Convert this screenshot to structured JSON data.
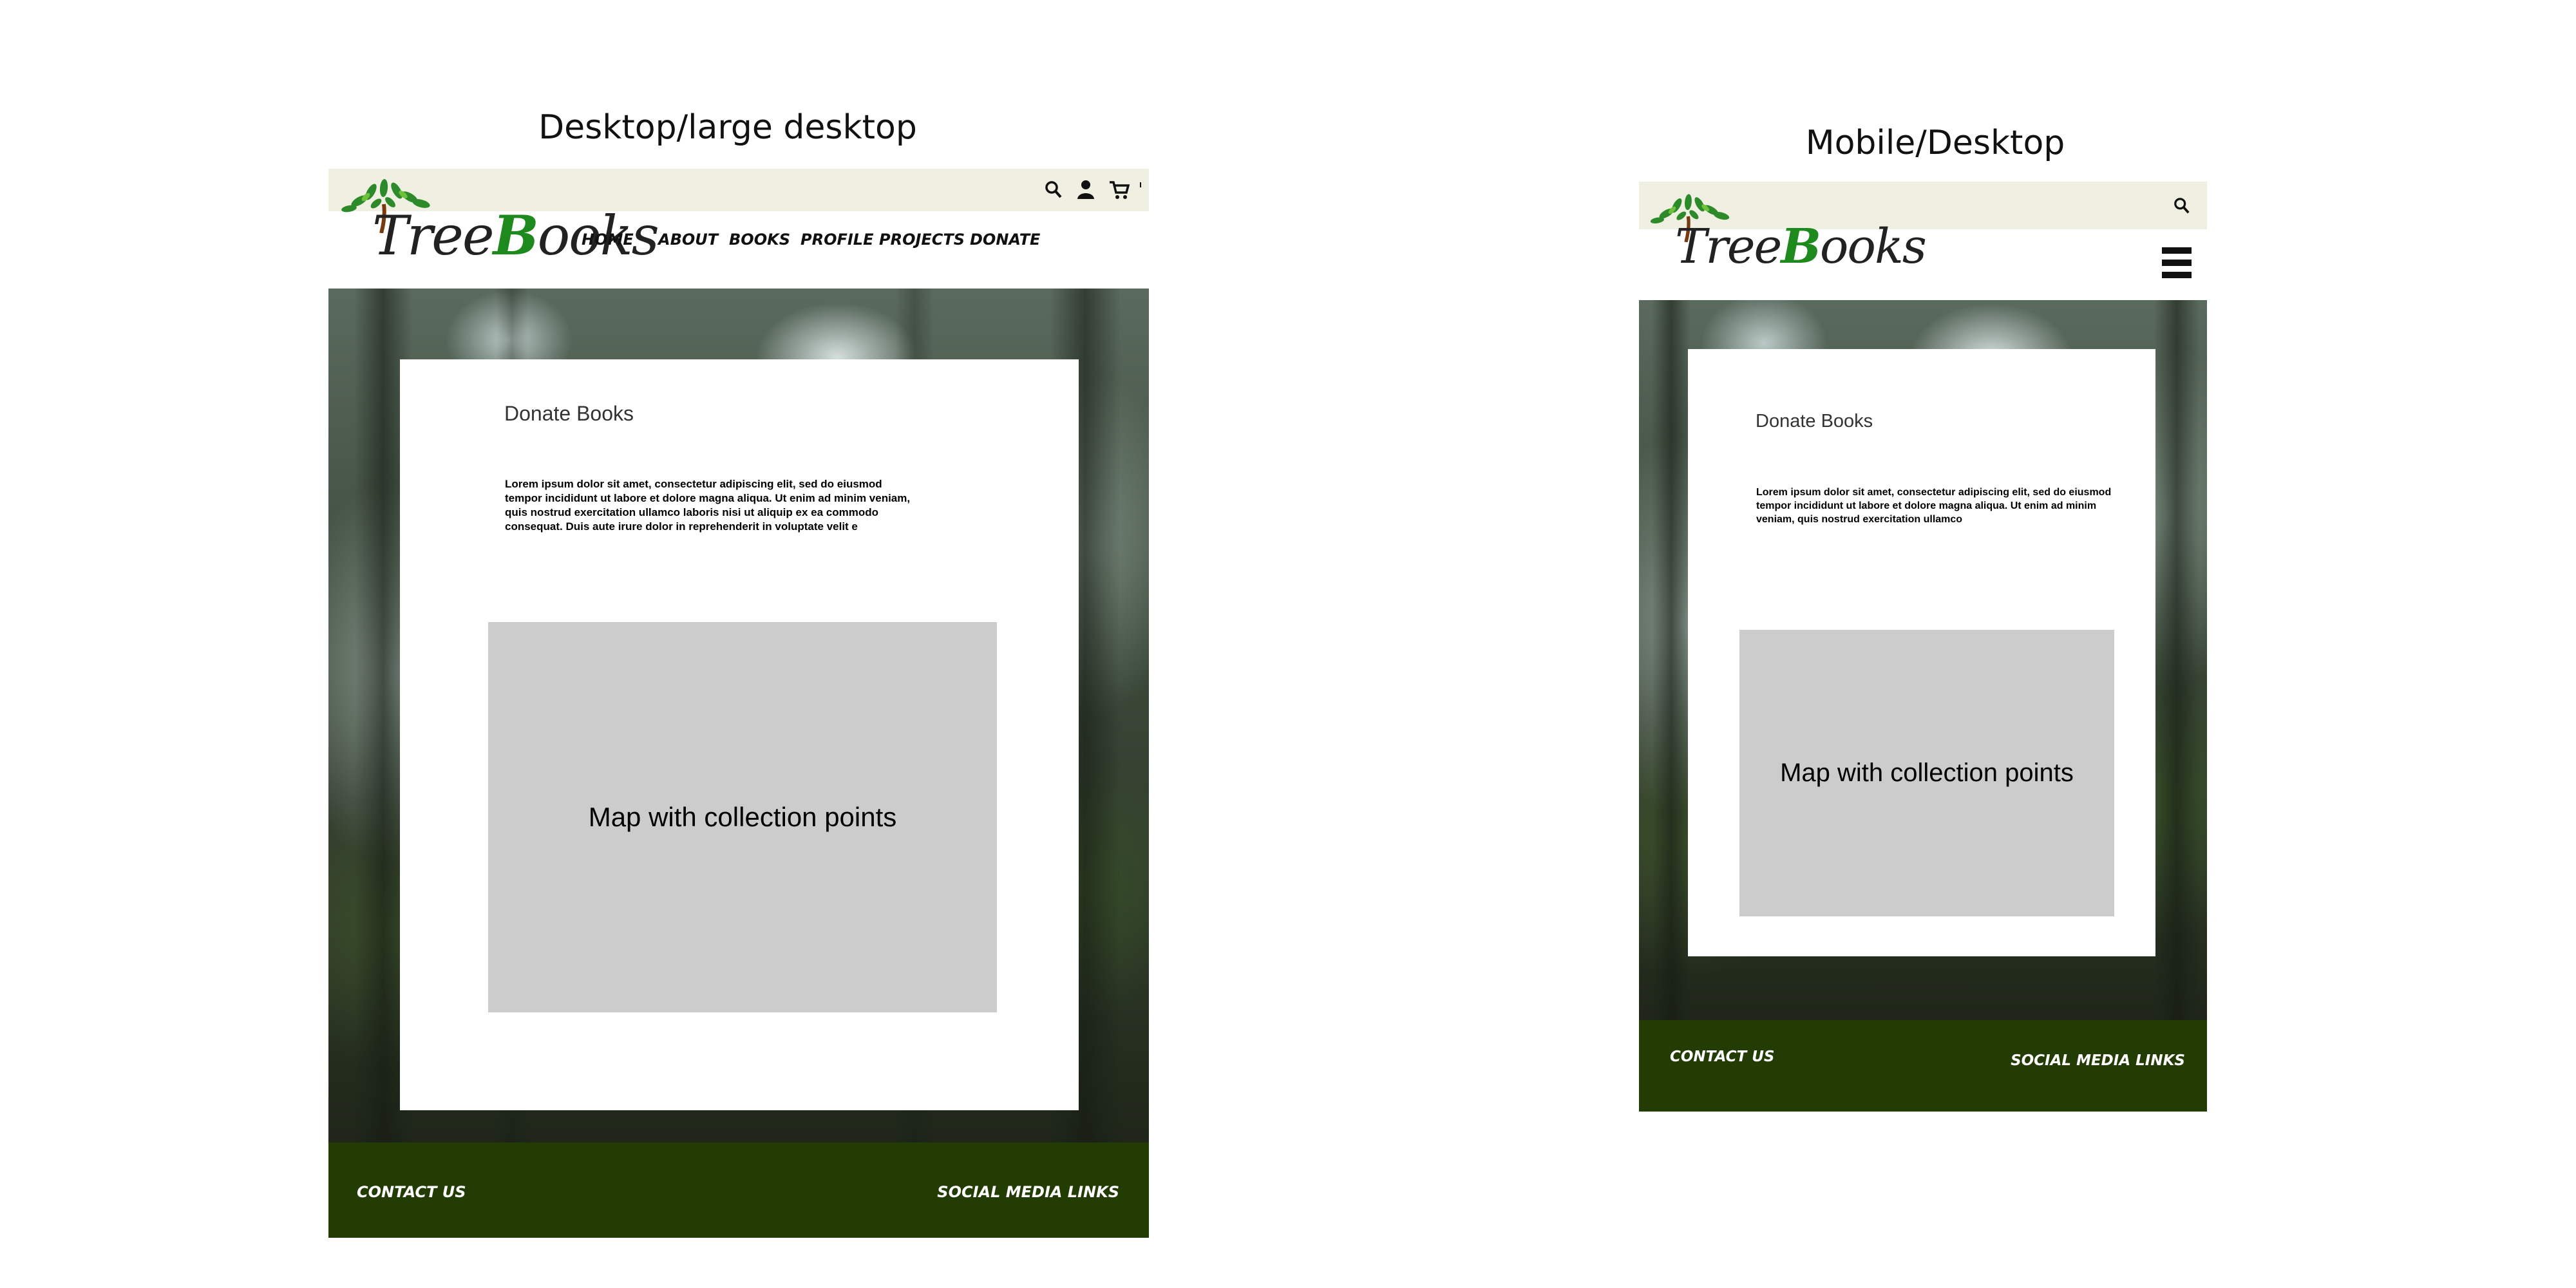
{
  "desktop": {
    "heading": "Desktop/large desktop",
    "logo": {
      "text_before": "Tree",
      "text_b": "B",
      "text_after": "ooks"
    },
    "nav": [
      {
        "label": "HOME"
      },
      {
        "label": "ABOUT"
      },
      {
        "label": "BOOKS"
      },
      {
        "label": "PROFILE"
      },
      {
        "label": "PROJECTS"
      },
      {
        "label": "DONATE"
      }
    ],
    "icons": [
      "search-icon",
      "user-icon",
      "cart-icon"
    ],
    "card": {
      "title": "Donate Books",
      "body": "Lorem ipsum dolor sit amet, consectetur adipiscing elit, sed do eiusmod tempor incididunt ut labore et dolore magna aliqua. Ut enim ad minim veniam, quis nostrud exercitation ullamco laboris nisi ut aliquip ex ea commodo consequat. Duis aute irure dolor in reprehenderit in voluptate velit e",
      "map_label": "Map with collection points"
    },
    "footer": {
      "contact": "CONTACT US",
      "social": "SOCIAL MEDIA LINKS"
    }
  },
  "mobile": {
    "heading": "Mobile/Desktop",
    "logo": {
      "text_before": "Tree",
      "text_b": "B",
      "text_after": "ooks"
    },
    "icons": [
      "search-icon",
      "hamburger-menu-icon"
    ],
    "card": {
      "title": "Donate Books",
      "body": "Lorem ipsum dolor sit amet, consectetur adipiscing elit, sed do eiusmod tempor incididunt ut labore et dolore magna aliqua. Ut enim ad minim veniam, quis nostrud exercitation ullamco",
      "map_label": "Map with collection points"
    },
    "footer": {
      "contact": "CONTACT US",
      "social": "SOCIAL MEDIA LINKS"
    }
  },
  "colors": {
    "topbar": "#efefe2",
    "footer": "#223c04",
    "map": "#cccccc",
    "logo_green": "#1e8a1e"
  }
}
